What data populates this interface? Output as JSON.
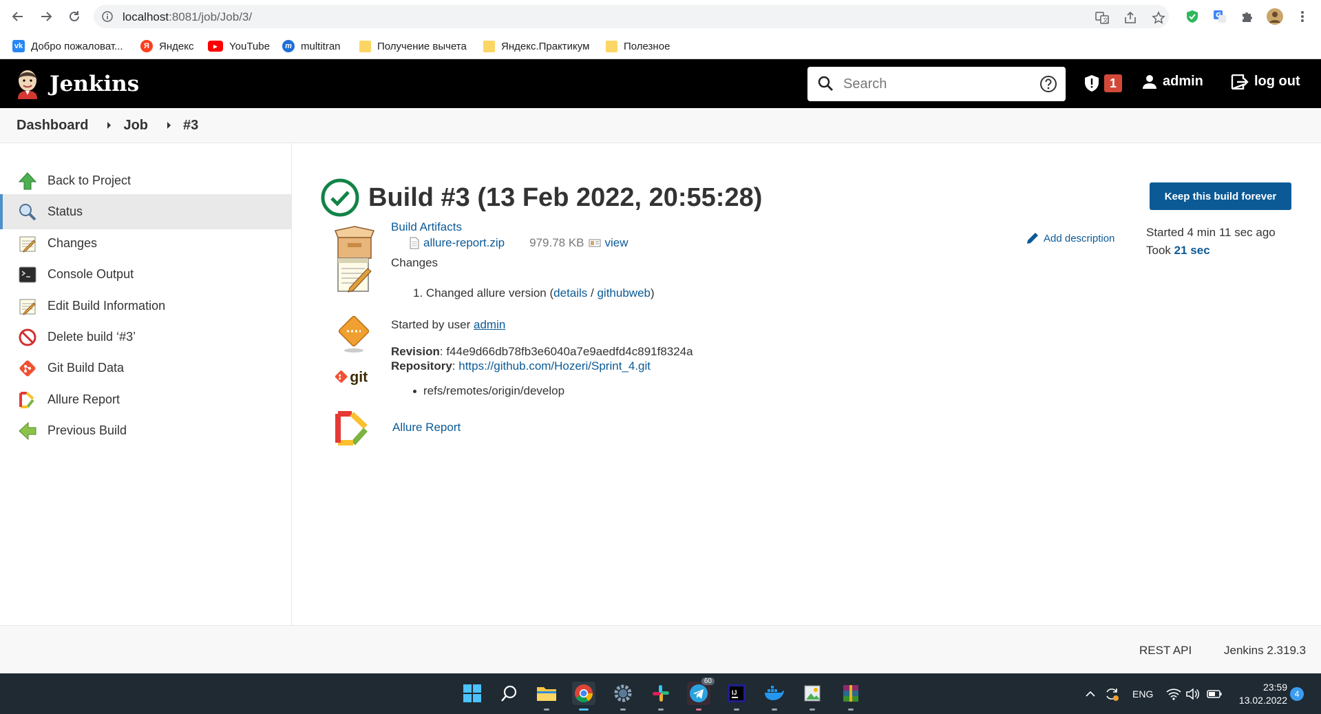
{
  "browser": {
    "url_host": "localhost",
    "url_rest": ":8081/job/Job/3/",
    "bookmarks": [
      {
        "label": "Добро пожаловат...",
        "icon": "vk-icon",
        "color": "#2787f5",
        "glyph": "vk"
      },
      {
        "label": "Яндекс",
        "icon": "yandex-icon",
        "color": "#fc3f1d",
        "glyph": "Я"
      },
      {
        "label": "YouTube",
        "icon": "youtube-icon",
        "color": "#ff0000",
        "glyph": "▶"
      },
      {
        "label": "multitran",
        "icon": "multitran-icon",
        "color": "#1e6fd9",
        "glyph": "m"
      },
      {
        "label": "Получение вычета",
        "icon": "folder-icon"
      },
      {
        "label": "Яндекс.Практикум",
        "icon": "folder-icon"
      },
      {
        "label": "Полезное",
        "icon": "folder-icon"
      }
    ]
  },
  "header": {
    "brand": "Jenkins",
    "search_placeholder": "Search",
    "security_count": "1",
    "user": "admin",
    "logout": "log out"
  },
  "breadcrumb": [
    "Dashboard",
    "Job",
    "#3"
  ],
  "sidebar": {
    "items": [
      {
        "label": "Back to Project",
        "icon": "up-arrow-icon"
      },
      {
        "label": "Status",
        "icon": "magnifier-icon",
        "active": true
      },
      {
        "label": "Changes",
        "icon": "notepad-icon"
      },
      {
        "label": "Console Output",
        "icon": "terminal-icon"
      },
      {
        "label": "Edit Build Information",
        "icon": "notepad-edit-icon"
      },
      {
        "label": "Delete build ‘#3’",
        "icon": "no-entry-icon"
      },
      {
        "label": "Git Build Data",
        "icon": "git-icon"
      },
      {
        "label": "Allure Report",
        "icon": "allure-icon"
      },
      {
        "label": "Previous Build",
        "icon": "left-arrow-icon"
      }
    ]
  },
  "build": {
    "title": "Build #3 (13 Feb 2022, 20:55:28)",
    "keep_button": "Keep this build forever",
    "add_description": "Add description",
    "started_ago": "Started 4 min 11 sec ago",
    "took_prefix": "Took",
    "took_value": "21 sec"
  },
  "artifacts": {
    "heading": "Build Artifacts",
    "file": "allure-report.zip",
    "size": "979.78 KB",
    "view": "view"
  },
  "changes": {
    "heading": "Changes",
    "item_number": "1.",
    "item_text": "Changed allure version",
    "details": "details",
    "githubweb": "githubweb"
  },
  "started_by": {
    "prefix": "Started by user",
    "user": "admin"
  },
  "git": {
    "revision_label": "Revision",
    "revision": "f44e9d66db78fb3e6040a7e9aedfd4c891f8324a",
    "repository_label": "Repository",
    "repository": "https://github.com/Hozeri/Sprint_4.git",
    "branch": "refs/remotes/origin/develop"
  },
  "allure": {
    "link": "Allure Report"
  },
  "footer": {
    "rest_api": "REST API",
    "version": "Jenkins 2.319.3"
  },
  "taskbar": {
    "lang": "ENG",
    "time": "23:59",
    "date": "13.02.2022",
    "notifications": "4",
    "telegram_badge": "60"
  },
  "colors": {
    "accent": "#0b5a96",
    "success": "#138347",
    "header_bg": "#000000",
    "badge": "#d24939"
  }
}
